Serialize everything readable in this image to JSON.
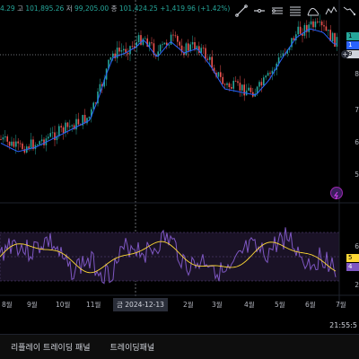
{
  "ohlc": {
    "open_partial": "4.29",
    "high_label": "고",
    "high": "101,895.26",
    "low_label": "저",
    "low": "99,205.00",
    "close_label": "종",
    "close": "101,424.25",
    "change": "+1,419.96 (+1.42%)"
  },
  "toolbar": {
    "icons": [
      "cursor-line-icon",
      "horizontal-line-icon",
      "ray-icon",
      "fib-icon",
      "pattern-icon",
      "zigzag-icon",
      "trend-down-icon"
    ]
  },
  "price_labels": {
    "label_1": "1",
    "label_2": "1",
    "label_3": "9",
    "rsi_label_1": "5",
    "rsi_label_2": "4"
  },
  "price_axis": {
    "ticks": [
      "8",
      "7",
      "6",
      "5"
    ]
  },
  "rsi_axis": {
    "ticks": [
      "6",
      "4",
      "2"
    ]
  },
  "x_axis": {
    "ticks": [
      "8월",
      "9월",
      "10월",
      "11월",
      "2월",
      "3월",
      "4월",
      "5월",
      "6월",
      "7월"
    ],
    "crosshair_date": "금 2024-12-13"
  },
  "clock": "21:55:5",
  "bottom_tabs": [
    "리플레이 트레이딩 패널",
    "트레이딩패널"
  ],
  "colors": {
    "up": "#26a69a",
    "down": "#ef5350",
    "ma": "#2962ff",
    "rsi": "#7e57c2",
    "rsi_ma": "#fdd835"
  }
}
